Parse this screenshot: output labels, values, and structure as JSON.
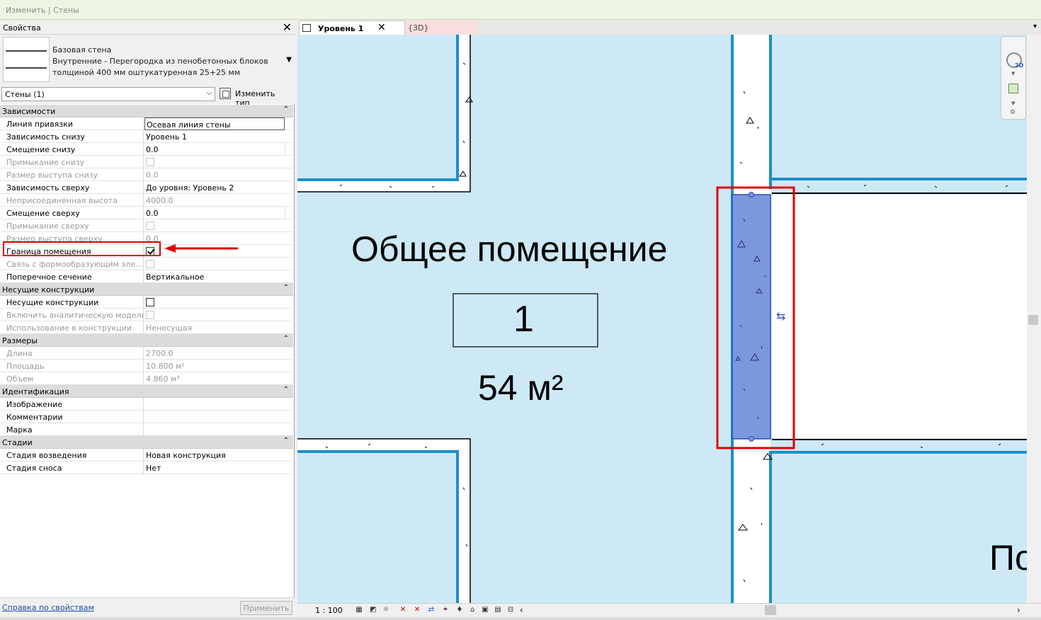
{
  "top_bar": {
    "title": "Изменить | Стены"
  },
  "properties": {
    "title": "Свойства",
    "close_icon": "close-icon",
    "type_selector": {
      "family": "Базовая стена",
      "type_line_1": "Внутренние - Перегородка из пенобетонных блоков",
      "type_line_2": "толщиной 400 мм оштукатуренная 25+25 мм"
    },
    "filter_value": "Стены (1)",
    "edit_type_label": "Изменить тип",
    "groups": {
      "constraints": {
        "title": "Зависимости",
        "rows": [
          {
            "name": "Линия привязки",
            "value": "Осевая линия стены"
          },
          {
            "name": "Зависимость снизу",
            "value": "Уровень 1"
          },
          {
            "name": "Смещение снизу",
            "value": "0.0"
          },
          {
            "name": "Примыкание снизу",
            "value": ""
          },
          {
            "name": "Размер выступа снизу",
            "value": "0.0"
          },
          {
            "name": "Зависимость сверху",
            "value": "До уровня: Уровень 2"
          },
          {
            "name": "Неприсоединенная высота",
            "value": "4000.0"
          },
          {
            "name": "Смещение сверху",
            "value": "0.0"
          },
          {
            "name": "Примыкание сверху",
            "value": ""
          },
          {
            "name": "Размер выступа сверху",
            "value": "0.0"
          },
          {
            "name": "Граница помещения",
            "value": ""
          },
          {
            "name": "Связь с формообразующим эле...",
            "value": ""
          },
          {
            "name": "Поперечное сечение",
            "value": "Вертикальное"
          }
        ]
      },
      "structural": {
        "title": "Несущие конструкции",
        "rows": [
          {
            "name": "Несущие конструкции",
            "value": ""
          },
          {
            "name": "Включить аналитическую модель",
            "value": ""
          },
          {
            "name": "Использование в конструкции",
            "value": "Ненесущая"
          }
        ]
      },
      "dimensions": {
        "title": "Размеры",
        "rows": [
          {
            "name": "Длина",
            "value": "2700.0"
          },
          {
            "name": "Площадь",
            "value": "10.800 м²"
          },
          {
            "name": "Объем",
            "value": "4.860 м³"
          }
        ]
      },
      "identity": {
        "title": "Идентификация",
        "rows": [
          {
            "name": "Изображение",
            "value": ""
          },
          {
            "name": "Комментарии",
            "value": ""
          },
          {
            "name": "Марка",
            "value": ""
          }
        ]
      },
      "phasing": {
        "title": "Стадии",
        "rows": [
          {
            "name": "Стадия возведения",
            "value": "Новая конструкция"
          },
          {
            "name": "Стадия сноса",
            "value": "Нет"
          }
        ]
      }
    },
    "checkboxes": {
      "bottom_attached": false,
      "top_attached": false,
      "room_bounding": true,
      "related_to_mass": false,
      "structural": false,
      "analytical_model": false
    },
    "help_link": "Справка по свойствам",
    "apply_label": "Применить"
  },
  "tabs": [
    {
      "label": "Уровень 1",
      "active": true
    },
    {
      "label": "{3D}",
      "active": false
    }
  ],
  "canvas": {
    "room_name": "Общее помещение",
    "room_number": "1",
    "room_area": "54 м²",
    "partial_label": "По",
    "colors": {
      "room_fill": "#cde9f5",
      "boundary_blue": "#1a8fd0",
      "selected_wall": "#7b98dd",
      "highlight_red": "#e10000"
    }
  },
  "nav_bar": {
    "label_2d": "2D"
  },
  "status_bar": {
    "scale": "1 : 100"
  }
}
